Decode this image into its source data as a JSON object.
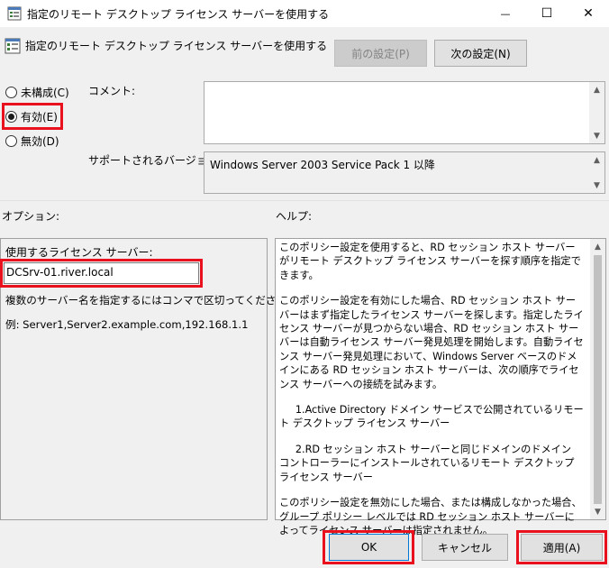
{
  "window": {
    "title": "指定のリモート デスクトップ ライセンス サーバーを使用する",
    "minimize": "—",
    "maximize": "☐",
    "close": "✕"
  },
  "header": {
    "policy_title": "指定のリモート デスクトップ ライセンス サーバーを使用する",
    "prev_button": "前の設定(P)",
    "next_button": "次の設定(N)"
  },
  "state": {
    "not_configured": "未構成(C)",
    "enabled": "有効(E)",
    "disabled": "無効(D)",
    "selected": "enabled"
  },
  "comment": {
    "label": "コメント:",
    "value": ""
  },
  "supported": {
    "label": "サポートされるバージョン:",
    "value": "Windows Server 2003 Service Pack 1 以降"
  },
  "options": {
    "section_label": "オプション:",
    "license_server_label": "使用するライセンス サーバー:",
    "license_server_value": "DCSrv-01.river.local",
    "hint": "複数のサーバー名を指定するにはコンマで区切ってください。",
    "example": "例: Server1,Server2.example.com,192.168.1.1"
  },
  "help": {
    "section_label": "ヘルプ:",
    "paragraphs": [
      "このポリシー設定を使用すると、RD セッション ホスト サーバーがリモート デスクトップ ライセンス サーバーを探す順序を指定できます。",
      "このポリシー設定を有効にした場合、RD セッション ホスト サーバーはまず指定したライセンス サーバーを探します。指定したライセンス サーバーが見つからない場合、RD セッション ホスト サーバーは自動ライセンス サーバー発見処理を開始します。自動ライセンス サーバー発見処理において、Windows Server ベースのドメインにある RD セッション ホスト サーバーは、次の順序でライセンス サーバーへの接続を試みます。",
      "1.Active Directory ドメイン サービスで公開されているリモート デスクトップ ライセンス サーバー",
      "2.RD セッション ホスト サーバーと同じドメインのドメイン コントローラーにインストールされているリモート デスクトップ ライセンス サーバー",
      "このポリシー設定を無効にした場合、または構成しなかった場合、グループ ポリシー レベルでは RD セッション ホスト サーバーによってライセンス サーバーは指定されません。"
    ]
  },
  "footer": {
    "ok": "OK",
    "cancel": "キャンセル",
    "apply": "適用(A)"
  },
  "colors": {
    "highlight": "#e8111d",
    "window_bg": "#f0f0f0"
  },
  "icons": {
    "title": "policy-settings-icon",
    "header": "policy-settings-icon"
  }
}
